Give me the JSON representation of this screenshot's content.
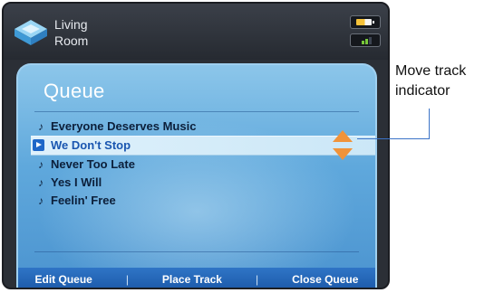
{
  "header": {
    "room_line1": "Living",
    "room_line2": "Room",
    "room_icon": "zone-icon",
    "battery_icon": "battery-icon",
    "signal_icon": "signal-icon"
  },
  "queue": {
    "title": "Queue",
    "tracks": [
      {
        "icon": "music-note-icon",
        "title": "Everyone Deserves Music"
      },
      {
        "icon": "play-icon",
        "title": "We Don't Stop",
        "selected": true
      },
      {
        "icon": "music-note-icon",
        "title": "Never Too Late"
      },
      {
        "icon": "music-note-icon",
        "title": "Yes I Will"
      },
      {
        "icon": "music-note-icon",
        "title": "Feelin' Free"
      }
    ],
    "move_indicator_icon": "up-down-arrows-icon"
  },
  "bottom_bar": {
    "edit_label": "Edit Queue",
    "place_label": "Place Track",
    "close_label": "Close Queue",
    "separator": "|"
  },
  "callout": {
    "line1": "Move track",
    "line2": "indicator"
  },
  "colors": {
    "panel": "#5fa8dc",
    "bottom_bar": "#2f75c6",
    "accent_arrows": "#f0933a",
    "selected_text": "#1a56b0"
  }
}
